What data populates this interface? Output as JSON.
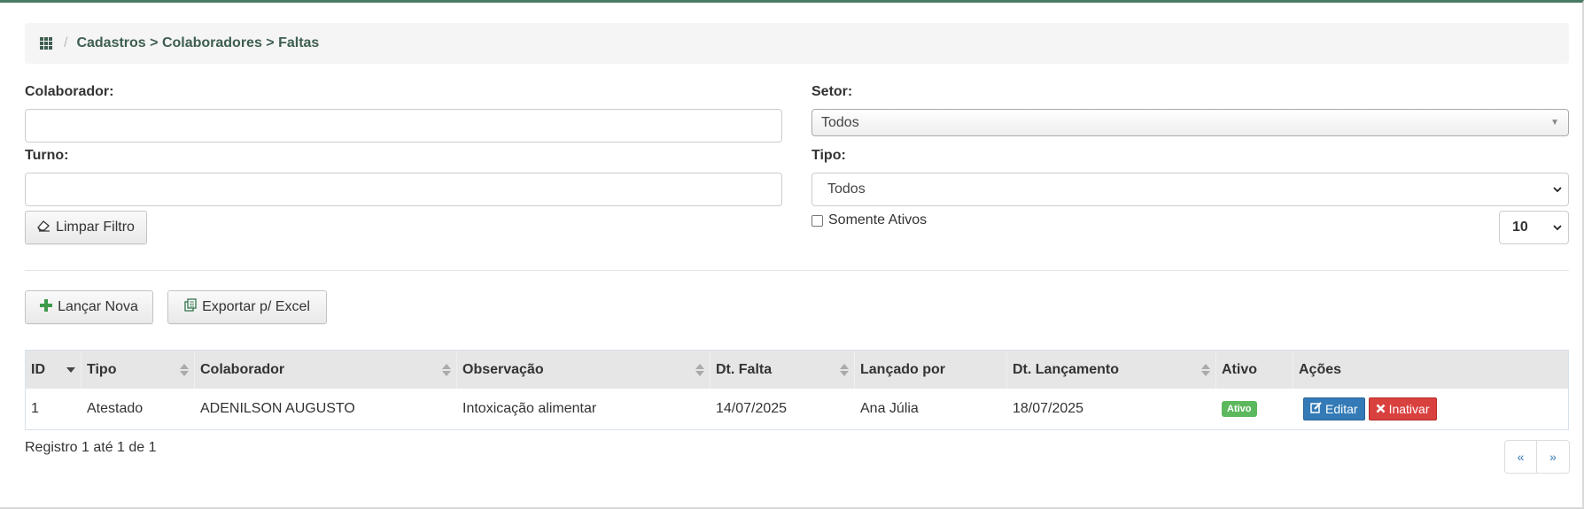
{
  "breadcrumb": {
    "path": "Cadastros > Colaboradores > Faltas",
    "separator": "/"
  },
  "filters": {
    "colaborador_label": "Colaborador:",
    "colaborador_value": "",
    "setor_label": "Setor:",
    "setor_value": "Todos",
    "turno_label": "Turno:",
    "turno_value": "",
    "tipo_label": "Tipo:",
    "tipo_value": "Todos",
    "clear_button": "Limpar Filtro",
    "only_active_label": "Somente Ativos",
    "page_size": "10"
  },
  "actions": {
    "new_button": "Lançar Nova",
    "export_button": "Exportar p/ Excel"
  },
  "table": {
    "columns": [
      "ID",
      "Tipo",
      "Colaborador",
      "Observação",
      "Dt. Falta",
      "Lançado por",
      "Dt. Lançamento",
      "Ativo",
      "Ações"
    ],
    "rows": [
      {
        "id": "1",
        "tipo": "Atestado",
        "colaborador": "ADENILSON AUGUSTO",
        "observacao": "Intoxicação alimentar",
        "dt_falta": "14/07/2025",
        "lancado_por": "Ana Júlia",
        "dt_lancamento": "18/07/2025",
        "ativo": "Ativo",
        "edit_label": "Editar",
        "inactivate_label": "Inativar"
      }
    ]
  },
  "footer": {
    "info": "Registro 1 até 1 de 1",
    "prev": "«",
    "next": "»"
  },
  "colors": {
    "accent": "#4a7a64",
    "primary": "#337ab7",
    "danger": "#d9413f",
    "success": "#5cb85c",
    "header_bg": "#e6e6e6"
  }
}
